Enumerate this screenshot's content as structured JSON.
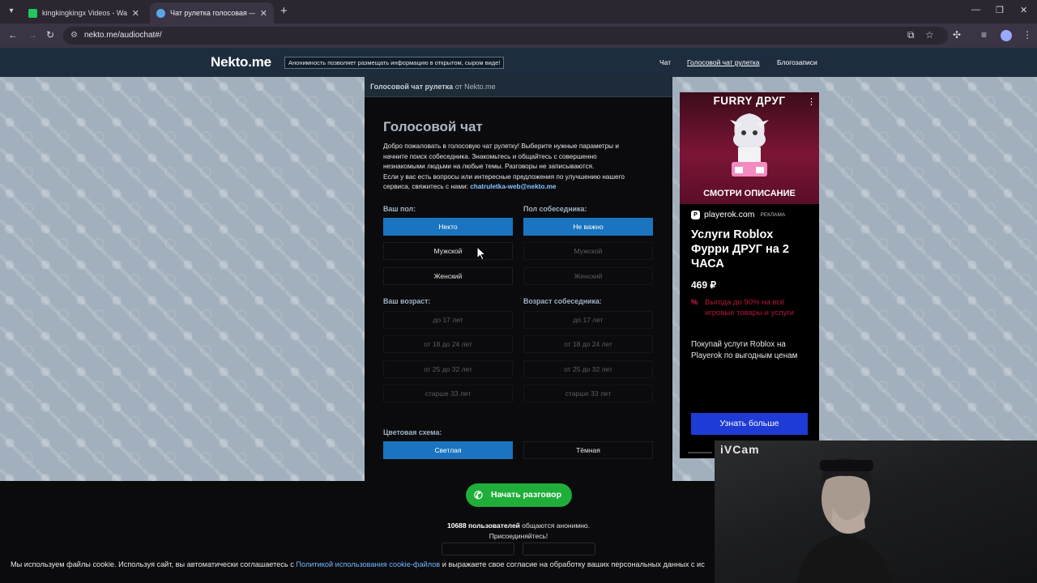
{
  "browser": {
    "tabs": [
      {
        "title": "kingkingkingx Videos - Watch (",
        "favicon_color": "#22c55e",
        "active": false
      },
      {
        "title": "Чат рулетка голосовая — Nek",
        "favicon_color": "#5aa7e6",
        "active": true
      }
    ],
    "url": "nekto.me/audiochat#/"
  },
  "site": {
    "logo": "Nekto.me",
    "slogan": "Анонимность позволяет размещать информацию в открытом, сыром виде!",
    "nav": [
      "Чат",
      "Голосовой чат рулетка",
      "Блогозаписи"
    ]
  },
  "panel": {
    "breadcrumb_bold": "Голосовой чат рулетка",
    "breadcrumb_rest": "от Nekto.me",
    "title": "Голосовой чат",
    "intro_lines": [
      "Добро пожаловать в голосовую чат рулетку! Выберите нужные параметры и",
      "начните поиск собеседника. Знакомьтесь и общайтесь с совершенно",
      "незнакомыми людьми на любые темы. Разговоры не записываются.",
      "Если у вас есть вопросы или интересные предложения по улучшению нашего"
    ],
    "intro_contact_prefix": "сервиса, свяжитесь с нами: ",
    "intro_email": "chatruletka-web@nekto.me",
    "your_gender_label": "Ваш пол:",
    "partner_gender_label": "Пол собеседника:",
    "your_gender_options": [
      "Некто",
      "Мужской",
      "Женский"
    ],
    "partner_gender_options": [
      "Не важно",
      "Мужской",
      "Женский"
    ],
    "your_age_label": "Ваш возраст:",
    "partner_age_label": "Возраст собеседника:",
    "age_options": [
      "до 17 лет",
      "от 18 до 24 лет",
      "от 25 до 32 лет",
      "старше 33 лет"
    ],
    "color_scheme_label": "Цветовая схема:",
    "color_scheme_options": [
      "Светлая",
      "Тёмная"
    ],
    "start_button": "Начать разговор",
    "online_count": "10688 пользователей",
    "online_suffix": " общаются анонимно.",
    "online_join": "Присоединяйтесь!"
  },
  "ad": {
    "top_title": "FURRY ДРУГ",
    "image_caption": "СМОТРИ ОПИСАНИЕ",
    "source": "playerok.com",
    "source_tag": "РЕКЛАМА",
    "headline": "Услуги Roblox Фурри ДРУГ на 2 ЧАСА",
    "price": "469 ₽",
    "promo": "Выгода до 90% на всё игровые товары и услуги",
    "description": "Покупай услуги Roblox на Playerok по выгодным ценам",
    "cta": "Узнать больше"
  },
  "webcam": {
    "label": "iVCam"
  },
  "cookie": {
    "text_before": "Мы используем файлы cookie. Используя сайт, вы автоматически соглашаетесь с ",
    "link": "Политикой использования cookie-файлов",
    "text_after": " и выражаете свое согласие на обработку ваших персональных данных с ис"
  },
  "colors": {
    "accent_blue": "#1a74bf",
    "start_green": "#1fae3a",
    "site_nav_bg": "#1d2d3e",
    "ad_cta": "#1f3bd6"
  }
}
